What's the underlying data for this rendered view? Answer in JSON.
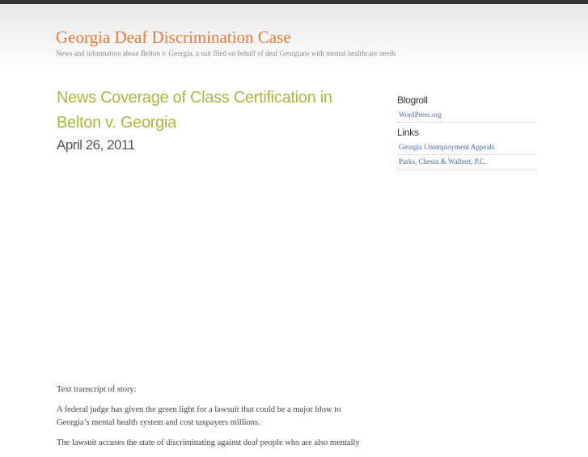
{
  "header": {
    "site_title": "Georgia Deaf Discrimination Case",
    "tagline": "News and information about Belton v. Georgia, a suit filed on behalf of deaf Georgians with mental healthcare needs"
  },
  "post": {
    "title": "News Coverage of Class Certification in Belton v. Georgia",
    "date": "April 26, 2011",
    "paragraphs": [
      "Text transcript of story:",
      "A federal judge has given the green light for a lawsuit that could be a major blow to Georgia’s mental health system and cost taxpayers millions.",
      "The lawsuit accuses the state of discriminating against deaf people who are also mentally"
    ]
  },
  "sidebar": {
    "blogroll_heading": "Blogroll",
    "blogroll": [
      {
        "label": "WordPress.org"
      }
    ],
    "links_heading": "Links",
    "links": [
      {
        "label": "Georgia Unemployment Appeals"
      },
      {
        "label": "Parks, Chesin & Walbert, P.C."
      }
    ]
  }
}
